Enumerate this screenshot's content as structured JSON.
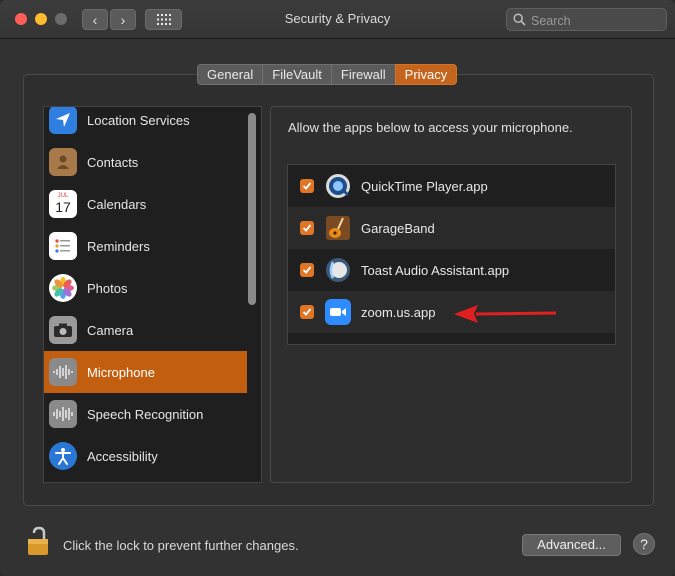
{
  "window": {
    "title": "Security & Privacy",
    "nav_back": "‹",
    "nav_forward": "›"
  },
  "search": {
    "placeholder": "Search"
  },
  "tabs": [
    {
      "label": "General",
      "active": false
    },
    {
      "label": "FileVault",
      "active": false
    },
    {
      "label": "Firewall",
      "active": false
    },
    {
      "label": "Privacy",
      "active": true
    }
  ],
  "sidebar": {
    "items": [
      {
        "label": "Location Services",
        "icon": "location-arrow-icon",
        "color": "#2f7fe0"
      },
      {
        "label": "Contacts",
        "icon": "contacts-book-icon",
        "color": "#a87a4a"
      },
      {
        "label": "Calendars",
        "icon": "calendar-icon",
        "color": "#ffffff",
        "calendar_month": "JUL",
        "calendar_day": "17"
      },
      {
        "label": "Reminders",
        "icon": "reminders-list-icon",
        "color": "#ffffff"
      },
      {
        "label": "Photos",
        "icon": "photos-flower-icon",
        "color": "#ffffff"
      },
      {
        "label": "Camera",
        "icon": "camera-icon",
        "color": "#9a9a9a"
      },
      {
        "label": "Microphone",
        "icon": "microphone-waveform-icon",
        "color": "#8a8a8a",
        "selected": true
      },
      {
        "label": "Speech Recognition",
        "icon": "speech-waveform-icon",
        "color": "#8a8a8a"
      },
      {
        "label": "Accessibility",
        "icon": "accessibility-person-icon",
        "color": "#2a78d6"
      }
    ]
  },
  "main": {
    "description": "Allow the apps below to access your microphone.",
    "apps": [
      {
        "label": "QuickTime Player.app",
        "checked": true,
        "icon": "quicktime-icon"
      },
      {
        "label": "GarageBand",
        "checked": true,
        "icon": "garageband-guitar-icon"
      },
      {
        "label": "Toast Audio Assistant.app",
        "checked": true,
        "icon": "toast-audio-icon"
      },
      {
        "label": "zoom.us.app",
        "checked": true,
        "icon": "zoom-camera-icon",
        "highlight_arrow": true
      }
    ]
  },
  "footer": {
    "lock_text": "Click the lock to prevent further changes.",
    "advanced_label": "Advanced...",
    "help_label": "?"
  },
  "colors": {
    "accent": "#c5641c",
    "checkbox": "#e07526",
    "arrow": "#e02020"
  }
}
